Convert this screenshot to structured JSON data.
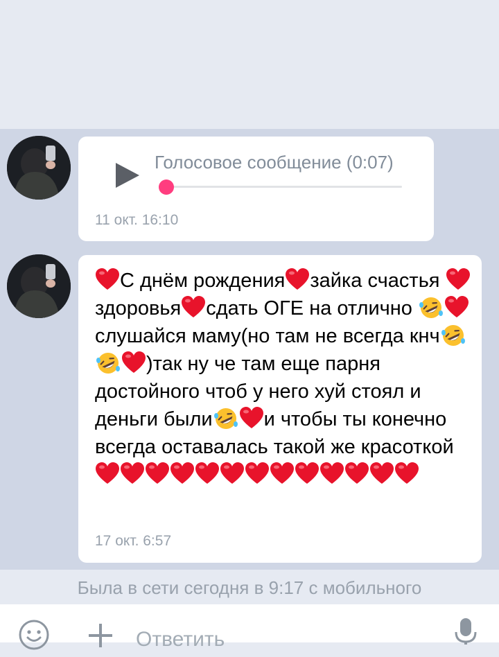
{
  "messages": [
    {
      "type": "voice",
      "title": "Голосовое сообщение (0:07)",
      "progress": 0.0,
      "time": "11 окт. 16:10"
    },
    {
      "type": "text",
      "segments": [
        {
          "e": "heart"
        },
        {
          "t": "С днём рождения"
        },
        {
          "e": "heart"
        },
        {
          "t": "зайка счастья "
        },
        {
          "e": "heart"
        },
        {
          "t": "здоровья"
        },
        {
          "e": "heart"
        },
        {
          "t": "сдать ОГЕ на отлично "
        },
        {
          "e": "laugh"
        },
        {
          "e": "heart"
        },
        {
          "t": "слушайся маму(но там не всегда кнч"
        },
        {
          "e": "laugh"
        },
        {
          "e": "laugh"
        },
        {
          "e": "heart"
        },
        {
          "t": ")так ну че там еще парня достойного чтоб у него хуй стоял и деньги были"
        },
        {
          "e": "laugh"
        },
        {
          "e": "heart"
        },
        {
          "t": "и чтобы ты конечно всегда оставалась такой же красоткой"
        },
        {
          "e": "heart"
        },
        {
          "e": "heart"
        },
        {
          "e": "heart"
        },
        {
          "e": "heart"
        },
        {
          "e": "heart"
        },
        {
          "e": "heart"
        },
        {
          "e": "heart"
        },
        {
          "e": "heart"
        },
        {
          "e": "heart"
        },
        {
          "e": "heart"
        },
        {
          "e": "heart"
        },
        {
          "e": "heart"
        },
        {
          "e": "heart"
        }
      ],
      "time": "17 окт. 6:57"
    }
  ],
  "status": "Была в сети сегодня в 9:17 с мобильного",
  "compose": {
    "placeholder": "Ответить"
  },
  "colors": {
    "chat_bg": "#cfd6e5",
    "knob": "#ff3d7f",
    "heart": "#e8132b"
  },
  "icons": {
    "play": "play-icon",
    "smile": "smile-icon",
    "attach": "plus-icon",
    "mic": "mic-icon"
  }
}
